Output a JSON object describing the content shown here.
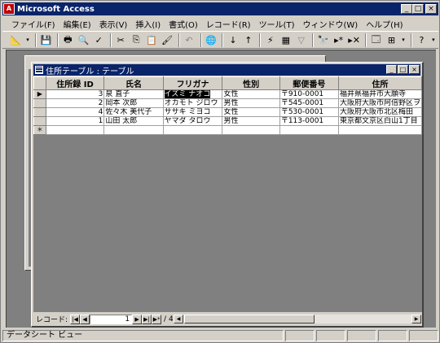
{
  "app": {
    "title": "Microsoft Access"
  },
  "menu": [
    "ファイル(F)",
    "編集(E)",
    "表示(V)",
    "挿入(I)",
    "書式(O)",
    "レコード(R)",
    "ツール(T)",
    "ウィンドウ(W)",
    "ヘルプ(H)"
  ],
  "table_window": {
    "title": "住所テーブル : テーブル",
    "columns": [
      "住所録 ID",
      "氏名",
      "フリガナ",
      "性別",
      "郵便番号",
      "住所"
    ],
    "rows": [
      {
        "selector": "▶",
        "id": "3",
        "name": "泉 直子",
        "kana": "イズミ ナオコ",
        "sex": "女性",
        "zip": "〒910-0001",
        "addr": "福井県福井市大願寺"
      },
      {
        "selector": "",
        "id": "2",
        "name": "岡本 次郎",
        "kana": "オカモト ジロウ",
        "sex": "男性",
        "zip": "〒545-0001",
        "addr": "大阪府大阪市阿倍野区ヲ"
      },
      {
        "selector": "",
        "id": "4",
        "name": "佐々木 美代子",
        "kana": "ササキ ミヨコ",
        "sex": "女性",
        "zip": "〒530-0001",
        "addr": "大阪府大阪市北区梅田"
      },
      {
        "selector": "",
        "id": "1",
        "name": "山田 太郎",
        "kana": "ヤマダ タロウ",
        "sex": "男性",
        "zip": "〒113-0001",
        "addr": "東京都文京区白山1丁目"
      },
      {
        "selector": "＊",
        "id": "",
        "name": "",
        "kana": "",
        "sex": "",
        "zip": "",
        "addr": ""
      }
    ],
    "nav": {
      "label": "レコード:",
      "current": "1",
      "total": "/ 4"
    }
  },
  "status": {
    "text": "データシート ビュー"
  }
}
